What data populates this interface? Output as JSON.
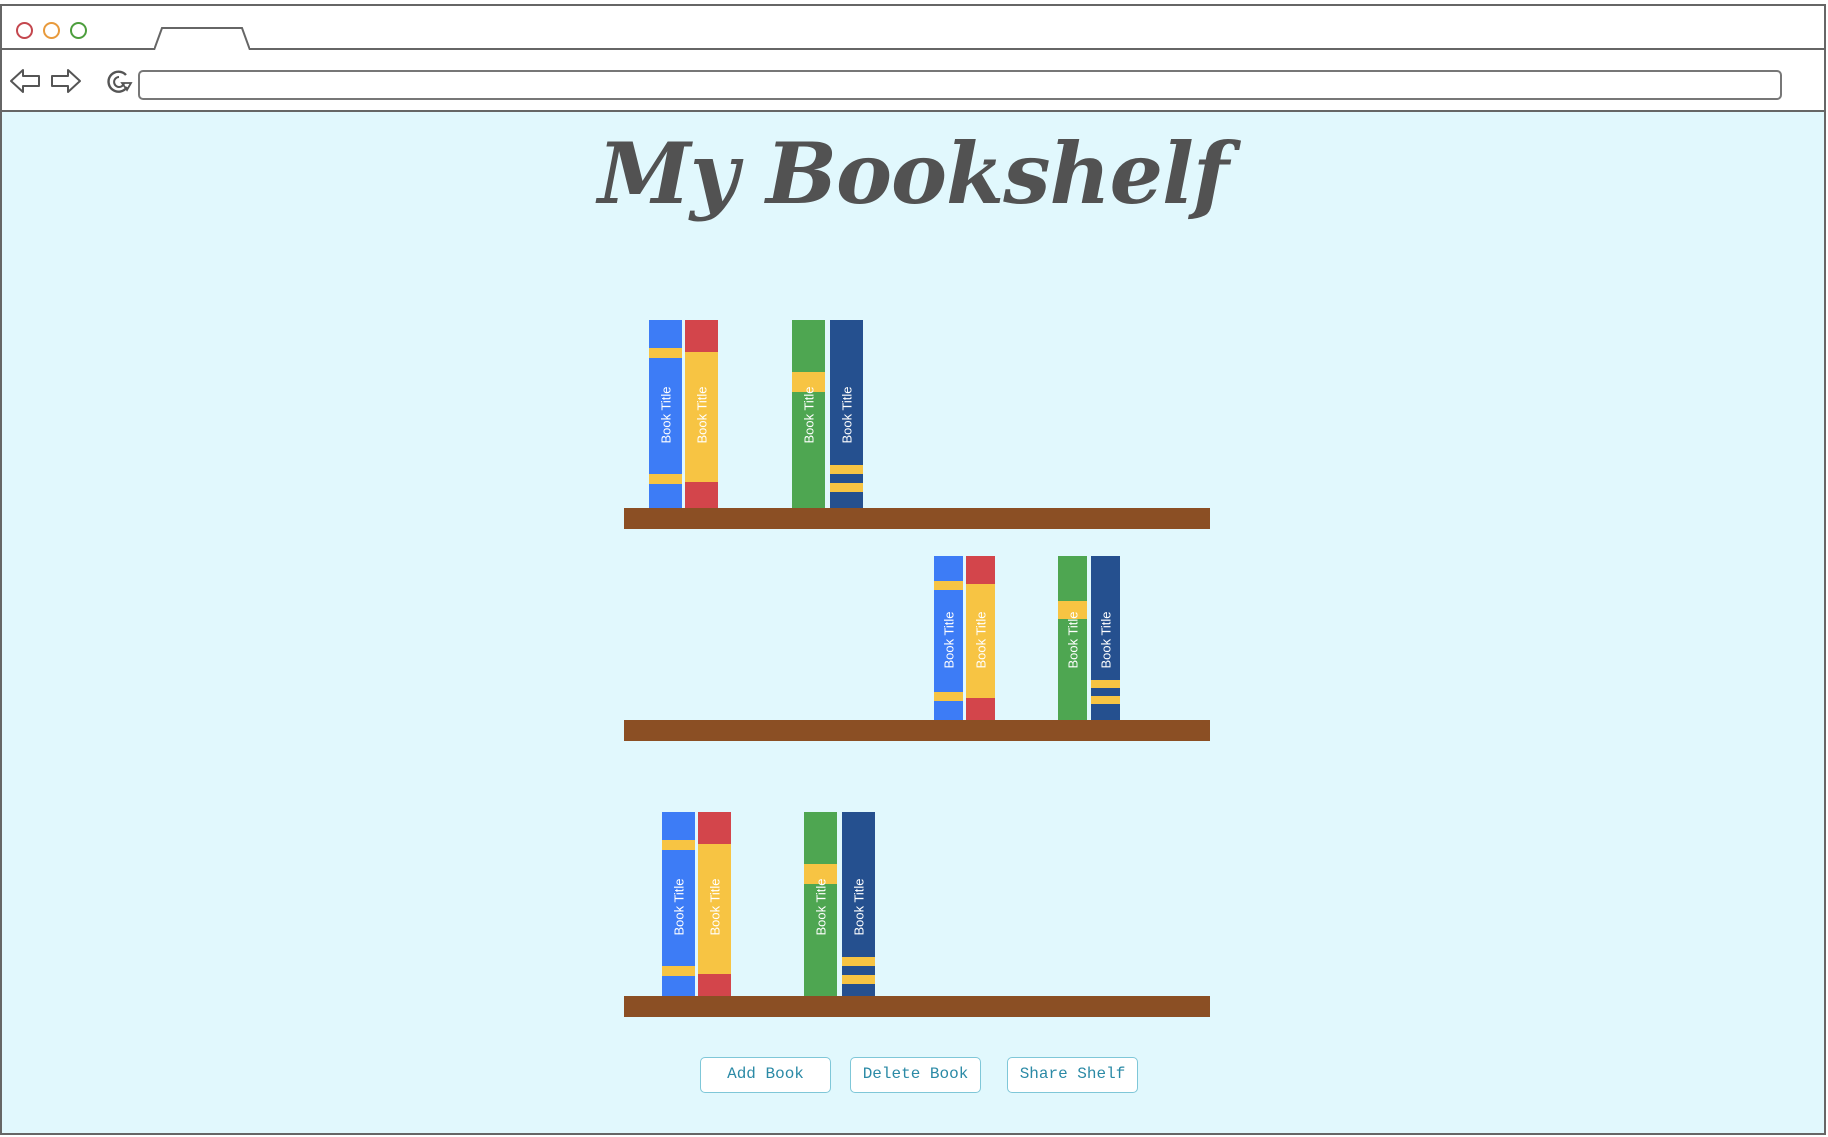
{
  "browser": {
    "address_value": "",
    "traffic_lights": [
      {
        "name": "close",
        "color": "#c4474e"
      },
      {
        "name": "minimize",
        "color": "#e89a3c"
      },
      {
        "name": "maximize",
        "color": "#4d9e3d"
      }
    ]
  },
  "page": {
    "title": "My Bookshelf",
    "background": "#e1f8fd"
  },
  "book_label": "Book Title",
  "colors": {
    "blue": "#3d7cf6",
    "red": "#d3454b",
    "yellow": "#f7c443",
    "green": "#4ea651",
    "navy": "#25508f",
    "shelf": "#8b4f24"
  },
  "shelves": [
    {
      "name": "shelf-1",
      "book_count": 4
    },
    {
      "name": "shelf-2",
      "book_count": 4
    },
    {
      "name": "shelf-3",
      "book_count": 4
    }
  ],
  "actions": {
    "add_book": "Add Book",
    "delete_book": "Delete Book",
    "share_shelf": "Share Shelf"
  }
}
